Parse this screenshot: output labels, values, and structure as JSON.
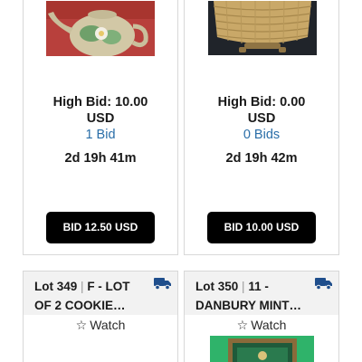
{
  "cards": [
    {
      "high_bid": "High Bid: 10.00",
      "currency": "USD",
      "bids": "1 Bid",
      "time_left": "2d 19h 41m",
      "button": "BID 12.50 USD",
      "image_icon": "teapot-photo"
    },
    {
      "high_bid": "High Bid: 0.00",
      "currency": "USD",
      "bids": "0 Bids",
      "time_left": "2d 19h 42m",
      "button": "BID 10.00 USD",
      "image_icon": "basket-photo"
    }
  ],
  "lots": [
    {
      "lot_label": "Lot 349",
      "separator": "|",
      "title": "F - LOT OF 2 COOKIE…",
      "watch": "Watch",
      "shipping_icon": "truck-icon",
      "watch_icon": "star-outline-icon"
    },
    {
      "lot_label": "Lot 350",
      "separator": "|",
      "title": "11 - DANBURY MINT…",
      "watch": "Watch",
      "shipping_icon": "truck-icon",
      "watch_icon": "star-outline-icon"
    }
  ],
  "colors": {
    "button_bg": "#000000",
    "bid_count": "#2a6ea8",
    "header_bg": "#f2f2f2",
    "truck": "#1f4e8c"
  }
}
